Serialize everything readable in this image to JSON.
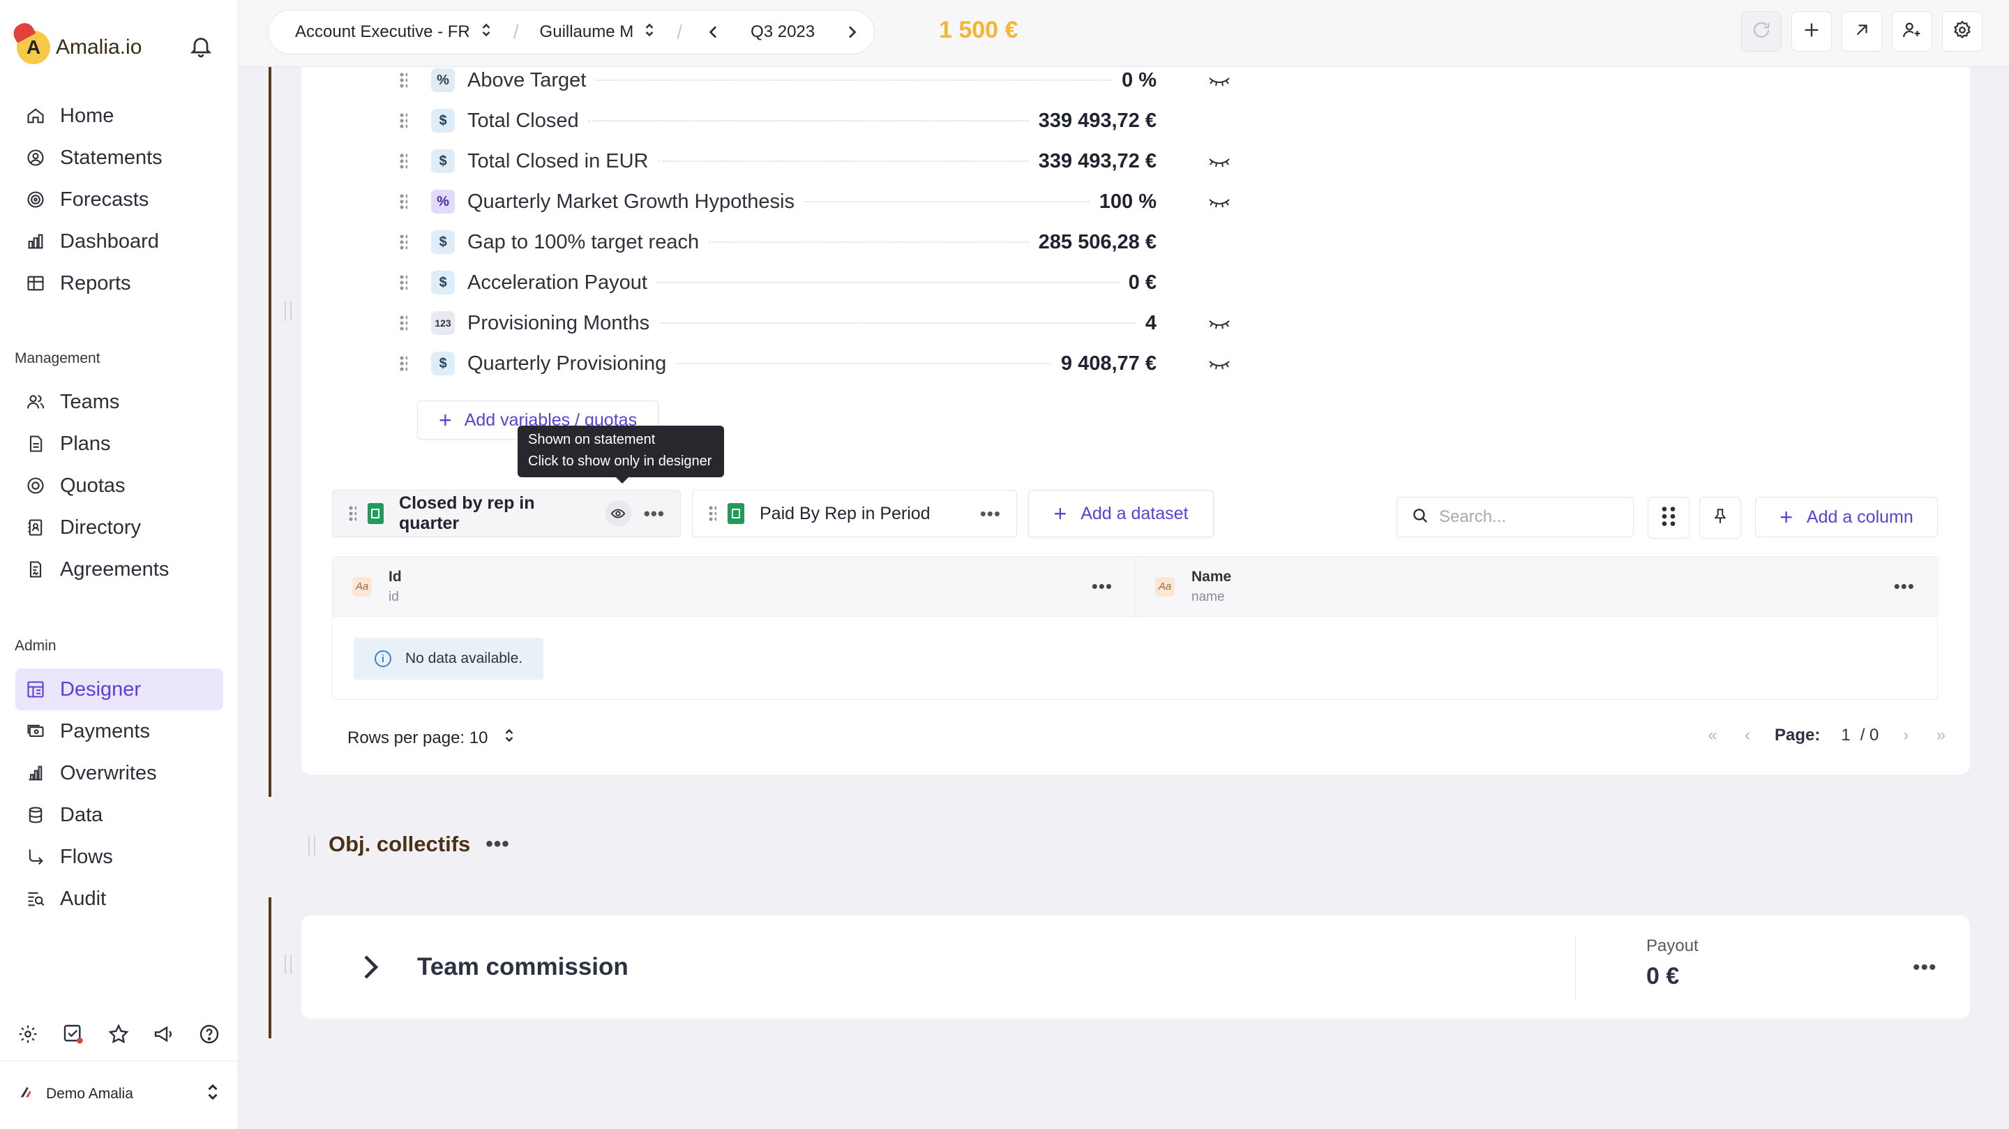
{
  "app": {
    "name": "Amalia.io"
  },
  "sidebar": {
    "main_items": [
      {
        "label": "Home",
        "icon": "home-icon"
      },
      {
        "label": "Statements",
        "icon": "user-circle-icon"
      },
      {
        "label": "Forecasts",
        "icon": "target-icon"
      },
      {
        "label": "Dashboard",
        "icon": "bar-chart-icon"
      },
      {
        "label": "Reports",
        "icon": "table-icon"
      }
    ],
    "management_label": "Management",
    "management_items": [
      {
        "label": "Teams",
        "icon": "users-icon"
      },
      {
        "label": "Plans",
        "icon": "document-icon"
      },
      {
        "label": "Quotas",
        "icon": "target-icon"
      },
      {
        "label": "Directory",
        "icon": "address-book-icon"
      },
      {
        "label": "Agreements",
        "icon": "signature-icon"
      }
    ],
    "admin_label": "Admin",
    "admin_items": [
      {
        "label": "Designer",
        "icon": "designer-icon",
        "active": true
      },
      {
        "label": "Payments",
        "icon": "payments-icon"
      },
      {
        "label": "Overwrites",
        "icon": "overwrites-icon"
      },
      {
        "label": "Data",
        "icon": "database-icon"
      },
      {
        "label": "Flows",
        "icon": "flow-icon"
      },
      {
        "label": "Audit",
        "icon": "audit-icon"
      }
    ],
    "account_name": "Demo Amalia"
  },
  "topbar": {
    "plan": "Account Executive - FR",
    "user": "Guillaume M",
    "period": "Q3 2023",
    "total": "1 500 €"
  },
  "variables": [
    {
      "name": "Above Target",
      "value": "0 %",
      "type": "pct",
      "hidden_on_statement": true
    },
    {
      "name": "Total Closed",
      "value": "339 493,72 €",
      "type": "currency",
      "hidden_on_statement": false
    },
    {
      "name": "Total Closed in EUR",
      "value": "339 493,72 €",
      "type": "currency",
      "hidden_on_statement": true
    },
    {
      "name": "Quarterly Market Growth Hypothesis",
      "value": "100 %",
      "type": "pct-highlight",
      "hidden_on_statement": true
    },
    {
      "name": "Gap to 100% target reach",
      "value": "285 506,28 €",
      "type": "currency",
      "hidden_on_statement": false
    },
    {
      "name": "Acceleration Payout",
      "value": "0 €",
      "type": "currency",
      "hidden_on_statement": false
    },
    {
      "name": "Provisioning Months",
      "value": "4",
      "type": "number",
      "hidden_on_statement": true
    },
    {
      "name": "Quarterly Provisioning",
      "value": "9 408,77 €",
      "type": "currency",
      "hidden_on_statement": true
    }
  ],
  "add_variables_label": "Add variables / quotas",
  "tooltip": {
    "line1": "Shown on statement",
    "line2": "Click to show only in designer"
  },
  "datasets": [
    {
      "label": "Closed by rep in quarter",
      "active": true
    },
    {
      "label": "Paid By Rep in Period",
      "active": false
    }
  ],
  "add_dataset_label": "Add a dataset",
  "search": {
    "placeholder": "Search..."
  },
  "add_column_label": "Add a column",
  "table": {
    "columns": [
      {
        "label": "Id",
        "key": "id"
      },
      {
        "label": "Name",
        "key": "name"
      }
    ],
    "empty_message": "No data available."
  },
  "pagination": {
    "rows_per_page_label": "Rows per page: 10",
    "page_label": "Page:",
    "current_page": "1",
    "total_pages": "/ 0"
  },
  "section": {
    "title": "Obj. collectifs"
  },
  "rule": {
    "title": "Team commission",
    "payout_label": "Payout",
    "payout_value": "0 €"
  },
  "colors": {
    "accent": "#5b3fd9",
    "total": "#f2b630",
    "section": "#4b3114"
  }
}
